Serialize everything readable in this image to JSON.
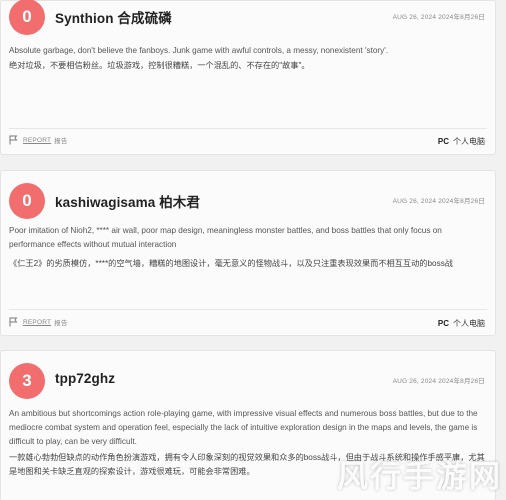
{
  "reviews": [
    {
      "score": "0",
      "username": "Synthion  合成硫磷",
      "date": "AUG 26, 2024 2024年8月26日",
      "body_en": "Absolute garbage, don't believe the fanboys. Junk game with awful controls, a messy, nonexistent 'story'.",
      "body_zh": "绝对垃圾，不要相信粉丝。垃圾游戏，控制很糟糕，一个混乱的、不存在的\"故事\"。",
      "report_label": "REPORT",
      "report_zh": "报告",
      "platform": "PC",
      "platform_zh": "个人电脑"
    },
    {
      "score": "0",
      "username": "kashiwagisama  柏木君",
      "date": "AUG 26, 2024 2024年8月26日",
      "body_en": "Poor imitation of Nioh2, **** air wall, poor map design, meaningless monster battles, and boss battles that only focus on performance effects without mutual interaction",
      "body_zh": "《仁王2》的劣质模仿，****的空气墙，糟糕的地图设计，毫无意义的怪物战斗，以及只注重表现效果而不相互互动的boss战",
      "report_label": "REPORT",
      "report_zh": "报告",
      "platform": "PC",
      "platform_zh": "个人电脑"
    },
    {
      "score": "3",
      "username": "tpp72ghz",
      "date": "AUG 26, 2024 2024年8月26日",
      "body_en": "An ambitious but shortcomings action role-playing game, with impressive visual effects and numerous boss battles, but due to the mediocre combat system and operation feel, especially the lack of intuitive exploration design in the maps and levels, the game is difficult to play, can be very difficult.",
      "body_zh": "一款雄心勃勃但缺点的动作角色扮演游戏，拥有令人印象深刻的视觉效果和众多的boss战斗，但由于战斗系统和操作手感平庸，尤其是地图和关卡缺乏直观的探索设计，游戏很难玩，可能会非常困难。"
    }
  ],
  "watermark": "风行手游网"
}
